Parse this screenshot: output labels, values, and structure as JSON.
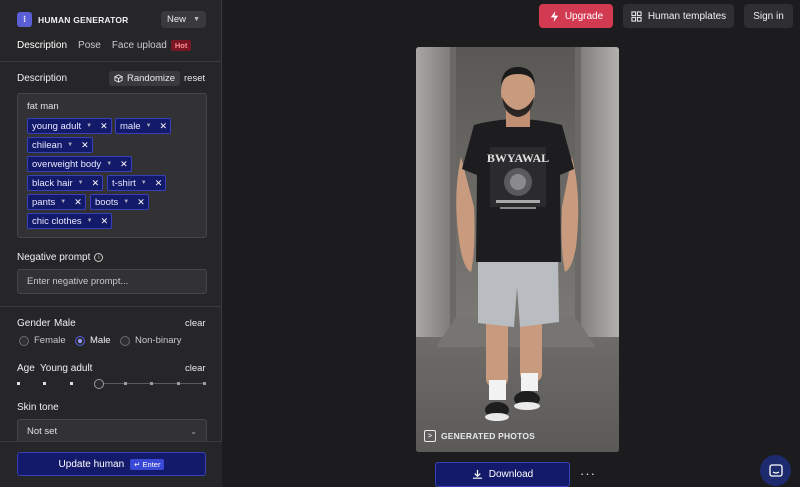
{
  "brand": {
    "name": "HUMAN GENERATOR"
  },
  "new_select": {
    "value": "New"
  },
  "tabs": [
    {
      "label": "Description"
    },
    {
      "label": "Pose"
    },
    {
      "label": "Face upload"
    }
  ],
  "hot_badge": "Hot",
  "description": {
    "label": "Description",
    "randomize": "Randomize",
    "reset": "reset",
    "prompt": "fat man",
    "chips": [
      "young adult",
      "male",
      "chilean",
      "overweight body",
      "black hair",
      "t-shirt",
      "pants",
      "boots",
      "chic clothes"
    ]
  },
  "negative": {
    "label": "Negative prompt",
    "placeholder": "Enter negative prompt..."
  },
  "gender": {
    "label": "Gender",
    "value": "Male",
    "clear": "clear",
    "options": [
      "Female",
      "Male",
      "Non-binary"
    ],
    "selected": "Male"
  },
  "age": {
    "label": "Age",
    "value": "Young adult",
    "clear": "clear"
  },
  "skin": {
    "label": "Skin tone",
    "value": "Not set"
  },
  "update": {
    "label": "Update human",
    "shortcut": "↵ Enter"
  },
  "header": {
    "upgrade": "Upgrade",
    "templates": "Human templates",
    "signin": "Sign in"
  },
  "photo": {
    "watermark": "GENERATED PHOTOS",
    "shirt_text": "BWYAWAL"
  },
  "download": {
    "label": "Download",
    "more": "···"
  },
  "colors": {
    "accent": "#141a6a",
    "upgrade": "#d23a52",
    "hot": "#7a1622"
  }
}
